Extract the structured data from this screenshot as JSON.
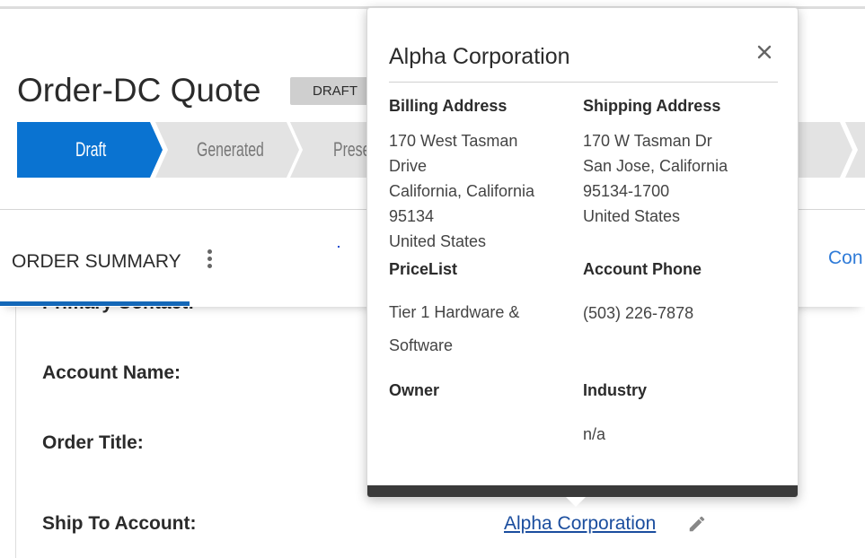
{
  "page": {
    "title": "Order-DC Quote",
    "status_badge": "DRAFT"
  },
  "path": {
    "steps": [
      {
        "label": "Draft",
        "state": "active"
      },
      {
        "label": "Generated",
        "state": "inactive"
      },
      {
        "label": "Presented",
        "state": "inactive"
      }
    ],
    "colors": {
      "active": "#0a73d1",
      "inactive": "#e3e3e3"
    }
  },
  "summary_bar": {
    "tab_label": "ORDER SUMMARY",
    "more_icon": "vertical-dots-icon",
    "right_link": "Con"
  },
  "fields": {
    "primary_contact_label": "Primary Contact:",
    "account_name_label": "Account Name:",
    "order_title_label": "Order Title:",
    "ship_to_account_label": "Ship To Account:",
    "ship_to_account_value": "Alpha Corporation",
    "edit_icon": "pencil-icon"
  },
  "popover": {
    "title": "Alpha Corporation",
    "close_icon": "close-icon",
    "billing_address": {
      "heading": "Billing Address",
      "lines": [
        "170 West Tasman",
        "Drive",
        "California, California",
        "95134",
        "United States"
      ]
    },
    "shipping_address": {
      "heading": "Shipping Address",
      "lines": [
        "170 W Tasman Dr",
        "San Jose, California",
        "95134-1700",
        "United States"
      ]
    },
    "pricelist": {
      "heading": "PriceList",
      "lines": [
        "Tier 1 Hardware &",
        "Software"
      ]
    },
    "account_phone": {
      "heading": "Account Phone",
      "value": "(503) 226-7878"
    },
    "owner": {
      "heading": "Owner",
      "value": ""
    },
    "industry": {
      "heading": "Industry",
      "value": "n/a"
    }
  }
}
